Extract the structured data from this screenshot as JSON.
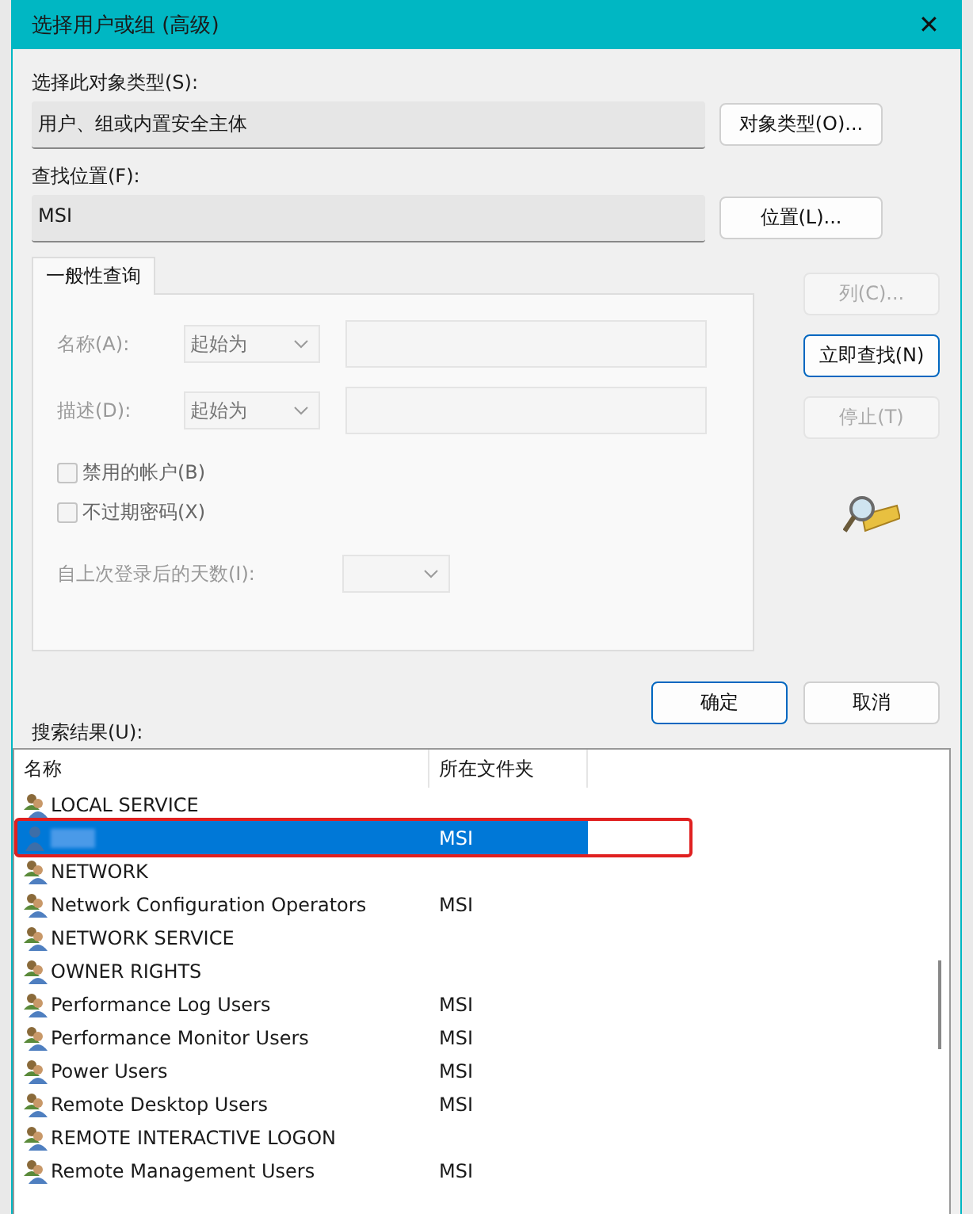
{
  "window": {
    "title": "选择用户或组 (高级)",
    "close": "✕"
  },
  "object_type": {
    "label": "选择此对象类型(S):",
    "value": "用户、组或内置安全主体",
    "button": "对象类型(O)..."
  },
  "location": {
    "label": "查找位置(F):",
    "value": "MSI",
    "button": "位置(L)..."
  },
  "tabs": [
    {
      "label": "一般性查询",
      "selected": true
    }
  ],
  "query": {
    "name_label": "名称(A):",
    "name_mode": "起始为",
    "desc_label": "描述(D):",
    "desc_mode": "起始为",
    "checkboxes": [
      {
        "label": "禁用的帐户(B)",
        "checked": false,
        "disabled": true
      },
      {
        "label": "不过期密码(X)",
        "checked": false,
        "disabled": true
      }
    ],
    "days_label": "自上次登录后的天数(I):"
  },
  "side_buttons": [
    {
      "label": "列(C)...",
      "disabled": true,
      "default": false
    },
    {
      "label": "立即查找(N)",
      "disabled": false,
      "default": true
    },
    {
      "label": "停止(T)",
      "disabled": true,
      "default": false
    }
  ],
  "dialog_buttons": [
    {
      "label": "确定",
      "default": true
    },
    {
      "label": "取消",
      "default": false
    }
  ],
  "results": {
    "label": "搜索结果(U):",
    "columns": [
      "名称",
      "所在文件夹"
    ],
    "rows": [
      {
        "kind": "group",
        "name": "LOCAL SERVICE",
        "selected": false
      },
      {
        "kind": "user",
        "folder": "MSI",
        "selected": true,
        "redacted": true
      },
      {
        "kind": "group",
        "name": "NETWORK",
        "selected": false
      },
      {
        "kind": "group",
        "name": "Network Configuration Operators",
        "folder": "MSI",
        "selected": false
      },
      {
        "kind": "group",
        "name": "NETWORK SERVICE",
        "selected": false
      },
      {
        "kind": "group",
        "name": "OWNER RIGHTS",
        "selected": false
      },
      {
        "kind": "group",
        "name": "Performance Log Users",
        "folder": "MSI",
        "selected": false
      },
      {
        "kind": "group",
        "name": "Performance Monitor Users",
        "folder": "MSI",
        "selected": false
      },
      {
        "kind": "group",
        "name": "Power Users",
        "folder": "MSI",
        "selected": false
      },
      {
        "kind": "group",
        "name": "Remote Desktop Users",
        "folder": "MSI",
        "selected": false
      },
      {
        "kind": "group",
        "name": "REMOTE INTERACTIVE LOGON",
        "selected": false
      },
      {
        "kind": "group",
        "name": "Remote Management Users",
        "folder": "MSI",
        "selected": false
      }
    ]
  }
}
